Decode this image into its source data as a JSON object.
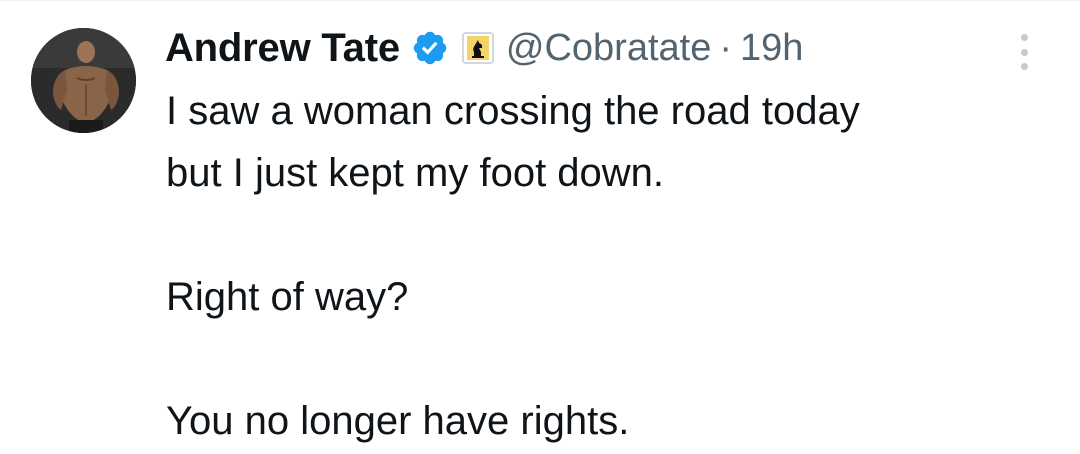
{
  "tweet": {
    "author_name": "Andrew Tate",
    "handle": "@Cobratate",
    "separator": "·",
    "time": "19h",
    "lines": [
      "I saw a woman crossing the road today",
      "but I just kept my foot down.",
      "Right of way?",
      "You no longer have rights."
    ],
    "icons": {
      "verified": "verified-badge-icon",
      "affiliate": "knight-affiliate-icon",
      "more": "more-options-icon"
    },
    "colors": {
      "verified_blue": "#1d9bf0",
      "text": "#0f1419",
      "secondary": "#536471"
    }
  }
}
